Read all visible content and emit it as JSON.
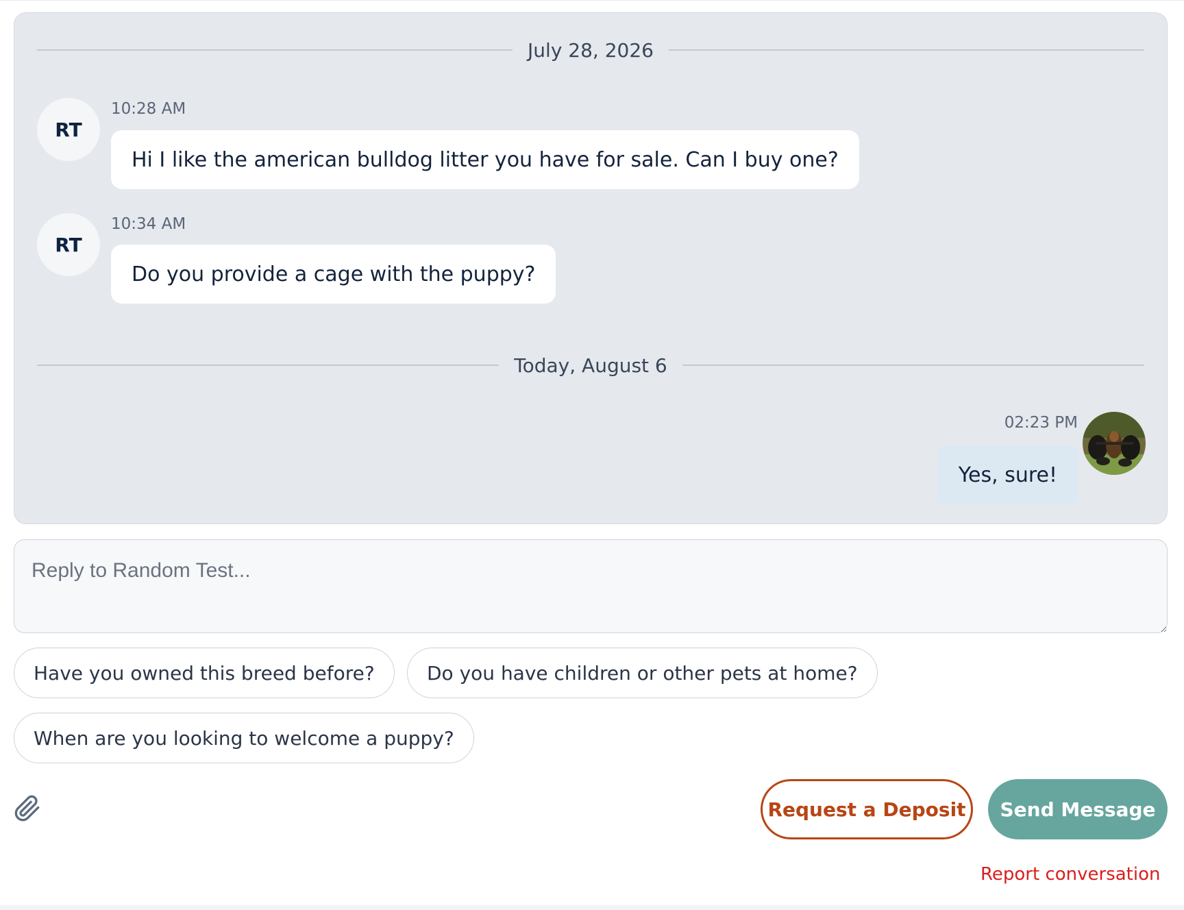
{
  "conversation": {
    "groups": [
      {
        "date_label": "July 28, 2026",
        "messages": [
          {
            "sender_initials": "RT",
            "time": "10:28 AM",
            "text": "Hi I like the american bulldog litter you have for sale. Can I buy one?"
          },
          {
            "sender_initials": "RT",
            "time": "10:34 AM",
            "text": "Do you provide a cage with the puppy?"
          }
        ]
      },
      {
        "date_label": "Today, August 6",
        "messages": [
          {
            "sender": "self",
            "time": "02:23 PM",
            "text": "Yes, sure!",
            "avatar": "dog-photo-avatar"
          }
        ]
      }
    ]
  },
  "reply": {
    "placeholder": "Reply to Random Test..."
  },
  "suggestions": [
    "Have you owned this breed before?",
    "Do you have children or other pets at home?",
    "When are you looking to welcome a puppy?"
  ],
  "actions": {
    "attach_icon": "paperclip-icon",
    "request_deposit": "Request a Deposit",
    "send_message": "Send Message",
    "report": "Report conversation"
  },
  "colors": {
    "panel_bg": "#e5e9ee",
    "deposit_accent": "#b84514",
    "send_bg": "#66a69e",
    "report_red": "#d91e1e",
    "own_bubble": "#dde9f2"
  }
}
